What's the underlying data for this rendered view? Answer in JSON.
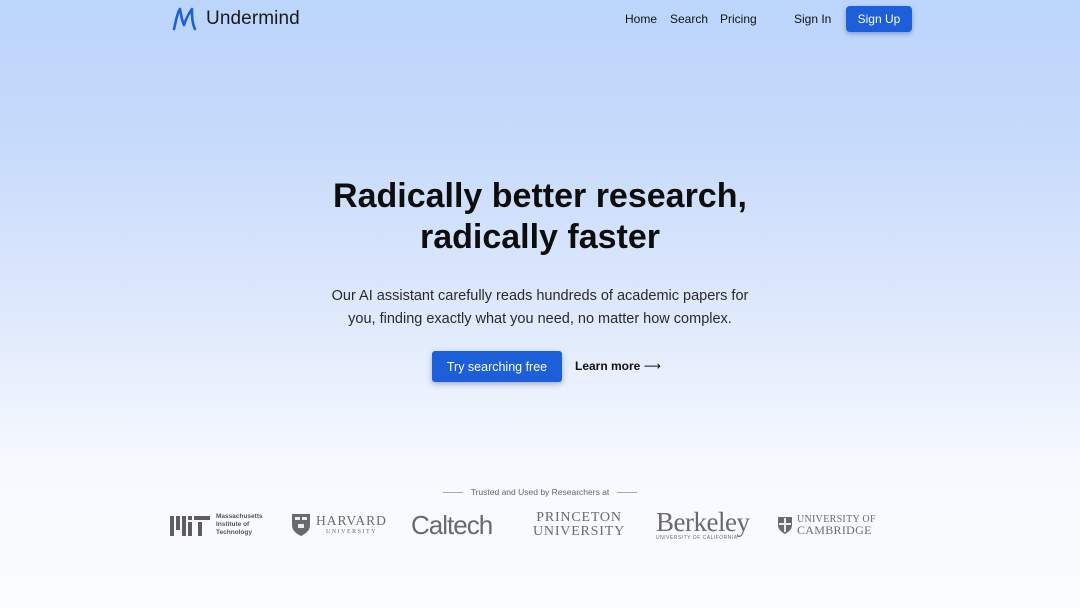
{
  "brand": {
    "name": "Undermind",
    "logo_icon": "undermind-m-logo"
  },
  "nav": {
    "links": [
      "Home",
      "Search",
      "Pricing"
    ],
    "sign_in": "Sign In",
    "sign_up": "Sign Up"
  },
  "hero": {
    "title_line1": "Radically better research,",
    "title_line2": "radically faster",
    "subtitle_line1": "Our AI assistant carefully reads hundreds of academic papers for",
    "subtitle_line2": "you, finding exactly what you need, no matter how complex.",
    "cta_primary": "Try searching free",
    "cta_secondary": "Learn more",
    "cta_secondary_arrow": "⟶"
  },
  "trusted": {
    "label": "Trusted and Used by Researchers at",
    "logos": {
      "mit": {
        "line1": "Massachusetts",
        "line2": "Institute of",
        "line3": "Technology"
      },
      "harvard": {
        "name": "HARVARD",
        "sub": "UNIVERSITY"
      },
      "caltech": {
        "name": "Caltech"
      },
      "princeton": {
        "name": "PRINCETON",
        "sub": "UNIVERSITY"
      },
      "berkeley": {
        "name": "Berkeley",
        "sub": "UNIVERSITY OF CALIFORNIA"
      },
      "cambridge": {
        "line1": "UNIVERSITY OF",
        "line2": "CAMBRIDGE"
      }
    }
  },
  "colors": {
    "primary": "#1d5fd9",
    "background_top": "#bcd5fb",
    "background_bottom": "#fbfcfe",
    "logo_gray": "#6a6a6a"
  }
}
